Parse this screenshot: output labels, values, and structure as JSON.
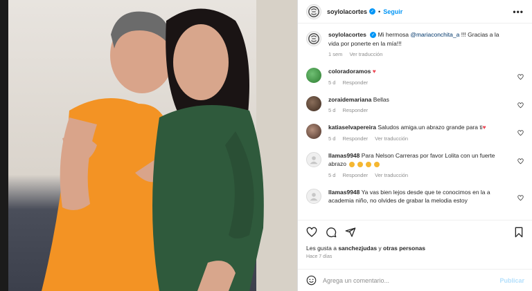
{
  "post": {
    "author": "soylolacortes",
    "follow_label": "Seguir",
    "more_label": "•••",
    "caption_author": "soylolacortes",
    "caption_pre": "Mi hermosa ",
    "caption_mention": "@mariaconchita_a",
    "caption_post": " !!! Gracias a la vida por ponerte en la mía!!!",
    "caption_time": "1 sem",
    "caption_translate": "Ver traducción"
  },
  "comments": [
    {
      "user": "coloradoramos",
      "text": "",
      "emoji": "red-heart",
      "time": "5 d",
      "reply": "Responder",
      "translate": ""
    },
    {
      "user": "zoraidemariana",
      "text": "Bellas",
      "time": "5 d",
      "reply": "Responder",
      "translate": ""
    },
    {
      "user": "katiaselvapereira",
      "text": "Saludos amiga.un abrazo grande para ti",
      "emoji": "red-heart",
      "time": "5 d",
      "reply": "Responder",
      "translate": "Ver traducción"
    },
    {
      "user": "llamas9948",
      "text": "Para Nelson Carreras por favor Lolita con un fuerte abrazo",
      "emoji": "smiley-faces",
      "time": "5 d",
      "reply": "Responder",
      "translate": "Ver traducción"
    },
    {
      "user": "llamas9948",
      "text": "Ya vas bien lejos desde que te conocimos en la a academia niño, no olvides de grabar la melodia estoy"
    }
  ],
  "engagement": {
    "likes_prefix": "Les gusta a ",
    "likes_user": "sanchezjudas",
    "likes_mid": " y ",
    "likes_others": "otras personas",
    "posted_ago": "Hace 7 días"
  },
  "composer": {
    "placeholder": "Agrega un comentario...",
    "publish_label": "Publicar"
  },
  "colors": {
    "accent": "#0095f6",
    "heart": "#ed4956",
    "mention": "#00376b",
    "muted": "#8e8e8e"
  }
}
